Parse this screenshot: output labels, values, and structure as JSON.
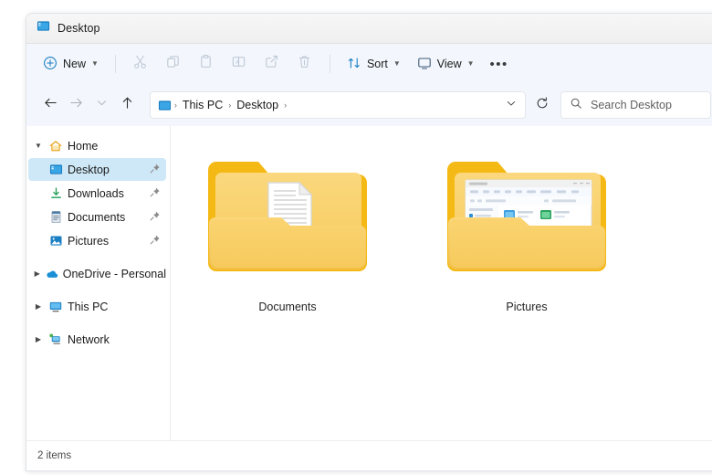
{
  "window": {
    "tab_title": "Desktop",
    "tab_icon": "folder-desktop-icon"
  },
  "toolbar": {
    "new_label": "New",
    "new_icon": "plus-circle-icon",
    "sort_label": "Sort",
    "sort_icon": "sort-arrows-icon",
    "view_label": "View",
    "view_icon": "monitor-icon",
    "more_label": "•••",
    "actions": [
      {
        "name": "cut",
        "icon": "scissors-icon",
        "enabled": false
      },
      {
        "name": "copy",
        "icon": "copy-icon",
        "enabled": false
      },
      {
        "name": "paste",
        "icon": "paste-icon",
        "enabled": false
      },
      {
        "name": "rename",
        "icon": "rename-icon",
        "enabled": false
      },
      {
        "name": "share",
        "icon": "share-icon",
        "enabled": false
      },
      {
        "name": "delete",
        "icon": "trash-icon",
        "enabled": false
      }
    ]
  },
  "navigation": {
    "back_icon": "arrow-left-icon",
    "forward_icon": "arrow-right-icon",
    "recent_icon": "chevron-down-icon",
    "up_icon": "arrow-up-icon",
    "refresh_icon": "refresh-icon",
    "address_dropdown_icon": "chevron-down-icon",
    "breadcrumb_icon": "folder-desktop-icon",
    "breadcrumbs": [
      "This PC",
      "Desktop"
    ],
    "separator": "›"
  },
  "search": {
    "placeholder": "Search Desktop",
    "value": "",
    "icon": "search-icon"
  },
  "sidebar": {
    "items": [
      {
        "label": "Home",
        "icon": "home-icon",
        "twisty": "⌄",
        "expanded": true,
        "indent": 0,
        "pinned": false,
        "selected": false
      },
      {
        "label": "Desktop",
        "icon": "desktop-icon",
        "twisty": "",
        "expanded": false,
        "indent": 1,
        "pinned": true,
        "selected": true
      },
      {
        "label": "Downloads",
        "icon": "downloads-icon",
        "twisty": "",
        "expanded": false,
        "indent": 1,
        "pinned": true,
        "selected": false
      },
      {
        "label": "Documents",
        "icon": "documents-icon",
        "twisty": "",
        "expanded": false,
        "indent": 1,
        "pinned": true,
        "selected": false
      },
      {
        "label": "Pictures",
        "icon": "pictures-icon",
        "twisty": "",
        "expanded": false,
        "indent": 1,
        "pinned": true,
        "selected": false
      },
      {
        "label": "OneDrive - Personal",
        "icon": "onedrive-cloud-icon",
        "twisty": "›",
        "expanded": false,
        "indent": 0,
        "pinned": false,
        "selected": false
      },
      {
        "label": "This PC",
        "icon": "this-pc-icon",
        "twisty": "›",
        "expanded": false,
        "indent": 0,
        "pinned": false,
        "selected": false
      },
      {
        "label": "Network",
        "icon": "network-icon",
        "twisty": "›",
        "expanded": false,
        "indent": 0,
        "pinned": false,
        "selected": false
      }
    ],
    "pin_icon": "pin-icon"
  },
  "content": {
    "items": [
      {
        "label": "Documents",
        "icon": "folder-with-document-icon"
      },
      {
        "label": "Pictures",
        "icon": "folder-with-screenshot-icon"
      }
    ]
  },
  "statusbar": {
    "item_count": "2 items"
  },
  "colors": {
    "accent_selection": "#cfe8f7",
    "folder_yellow": "#f6b81e",
    "folder_light": "#f8d67a",
    "toolbar_bg": "#f3f6fc",
    "titlebar_bg": "#f3f3f3"
  }
}
